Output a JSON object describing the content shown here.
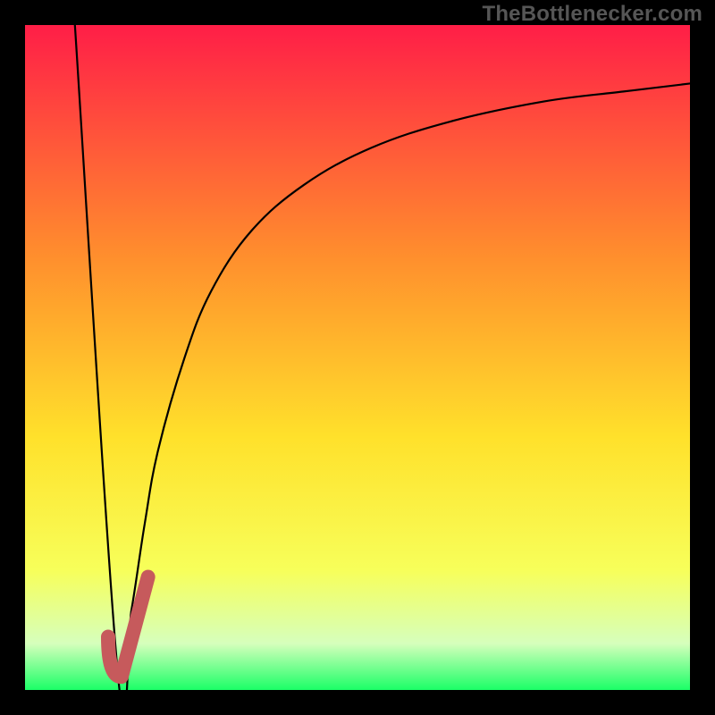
{
  "watermark": "TheBottlenecker.com",
  "colors": {
    "frame": "#000000",
    "watermark": "#565656",
    "curve": "#000000",
    "marker": "#c65a5c",
    "gradient_top": "#ff1e47",
    "gradient_mid_upper": "#ff8f2d",
    "gradient_mid": "#ffe12b",
    "gradient_mid_lower": "#f7ff5a",
    "gradient_near_bottom": "#d6ffbc",
    "gradient_bottom": "#1bff67"
  },
  "chart_data": {
    "type": "line",
    "title": "",
    "xlabel": "",
    "ylabel": "",
    "xlim": [
      0,
      100
    ],
    "ylim": [
      0,
      100
    ],
    "optimum_x": 14,
    "series": [
      {
        "name": "left-branch",
        "x": [
          7.5,
          14
        ],
        "values": [
          100,
          2
        ]
      },
      {
        "name": "right-branch",
        "x": [
          14,
          16,
          18,
          20,
          24,
          28,
          34,
          42,
          52,
          64,
          78,
          90,
          100
        ],
        "values": [
          2,
          12,
          25,
          36,
          50,
          60,
          69,
          76,
          81.5,
          85.5,
          88.5,
          90,
          91.2
        ]
      }
    ],
    "marker": {
      "name": "optimum-hook",
      "path_x": [
        12.5,
        14.5,
        18.5
      ],
      "path_y": [
        8,
        2,
        17
      ]
    }
  }
}
